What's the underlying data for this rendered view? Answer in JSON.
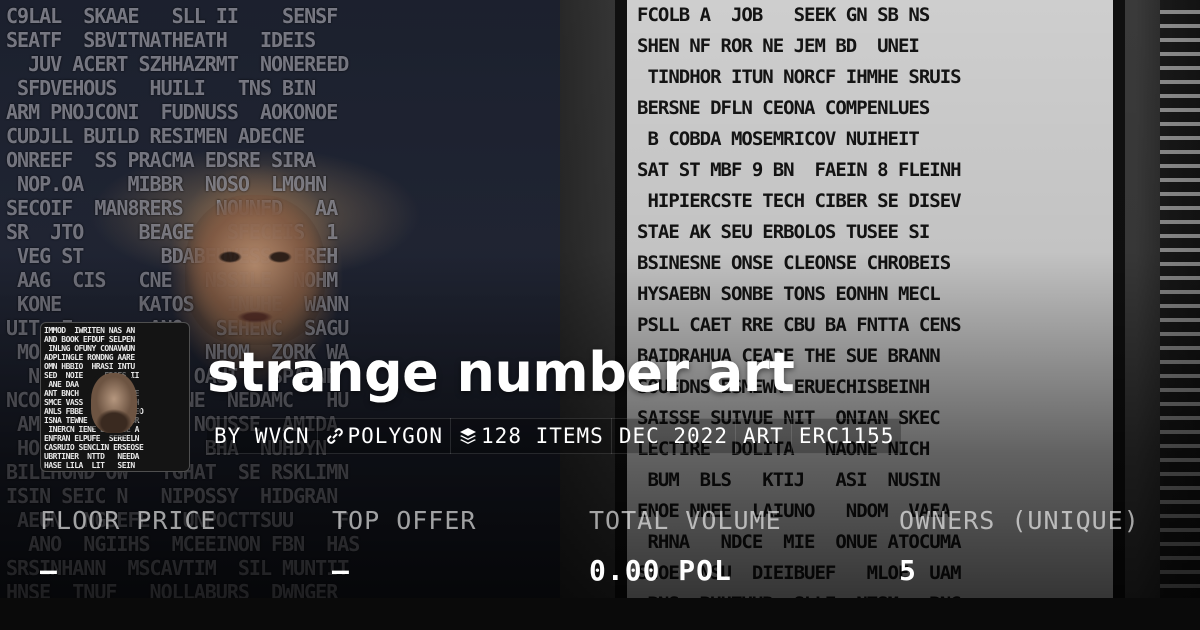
{
  "collection": {
    "name": "strange number art",
    "creator": "BY WVCN",
    "chain": "POLYGON",
    "items": "128 ITEMS",
    "created": "DEC 2022",
    "category": "ART",
    "standard": "ERC1155"
  },
  "icons": {
    "chain": "polygon-link-icon",
    "items": "layers-stack-icon"
  },
  "stats": [
    {
      "label": "FLOOR PRICE",
      "value": "–"
    },
    {
      "label": "TOP OFFER",
      "value": "–"
    },
    {
      "label": "TOTAL VOLUME",
      "value": "0.00 POL"
    },
    {
      "label": "OWNERS (UNIQUE)",
      "value": "5"
    }
  ],
  "colors": {
    "text": "#ffffff",
    "label": "#a3a3a3",
    "background": "#0b0b0d"
  }
}
